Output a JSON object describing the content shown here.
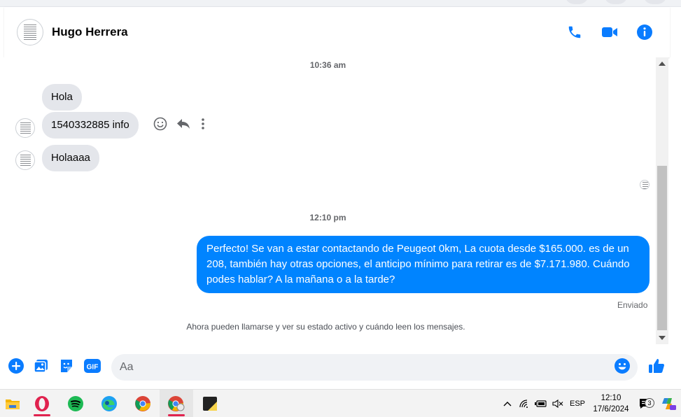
{
  "header": {
    "contact_name": "Hugo Herrera",
    "actions": [
      "phone-icon",
      "video-camera-icon",
      "info-icon"
    ]
  },
  "chat": {
    "timestamp_1": "10:36 am",
    "messages_in": [
      "Hola",
      "1540332885 info",
      "Holaaaa"
    ],
    "timestamp_2": "12:10 pm",
    "message_out": "Perfecto!  Se van a estar contactando de Peugeot 0km, La cuota desde $165.000. es de un 208, también hay otras opciones, el anticipo mínimo para retirar es de $7.171.980. Cuándo podes hablar? A la mañana o a la tarde?",
    "status": "Enviado",
    "notice": "Ahora pueden llamarse y ver su estado activo y cuándo leen los mensajes."
  },
  "composer": {
    "placeholder": "Aa",
    "value": "",
    "gif_label": "GIF"
  },
  "taskbar": {
    "apps": [
      "file-explorer",
      "opera",
      "spotify",
      "edge",
      "chrome",
      "chrome-profile",
      "sticky-notes"
    ],
    "lang": "ESP",
    "time": "12:10",
    "date": "17/6/2024",
    "notification_count": "3"
  },
  "colors": {
    "accent": "#0084ff",
    "bubble_in": "#e4e6eb",
    "icon_blue": "#0a7cff"
  }
}
